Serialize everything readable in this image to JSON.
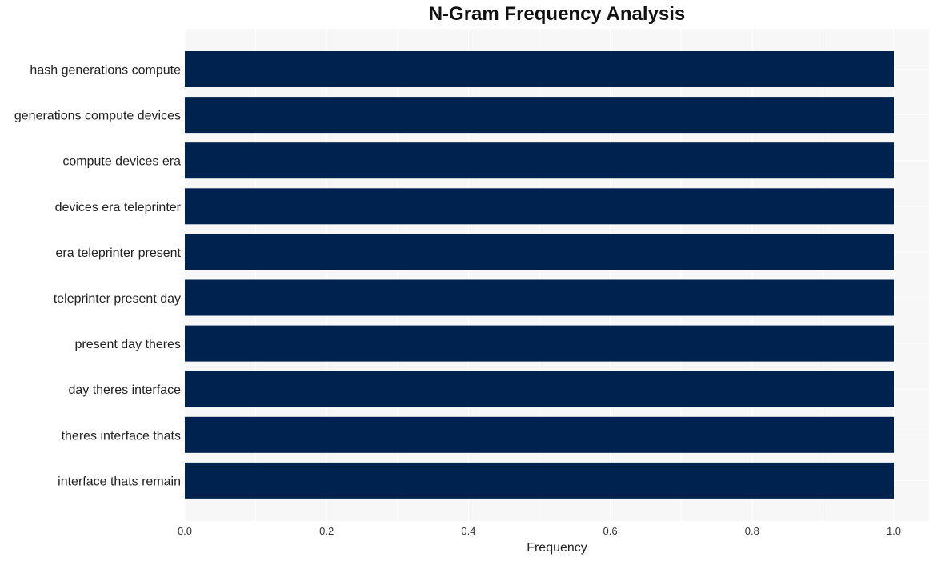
{
  "chart_data": {
    "type": "bar",
    "orientation": "horizontal",
    "title": "N-Gram Frequency Analysis",
    "xlabel": "Frequency",
    "ylabel": "",
    "categories": [
      "hash generations compute",
      "generations compute devices",
      "compute devices era",
      "devices era teleprinter",
      "era teleprinter present",
      "teleprinter present day",
      "present day theres",
      "day theres interface",
      "theres interface thats",
      "interface thats remain"
    ],
    "values": [
      1,
      1,
      1,
      1,
      1,
      1,
      1,
      1,
      1,
      1
    ],
    "xlim": [
      0,
      1.05
    ],
    "xticks": [
      0.0,
      0.2,
      0.4,
      0.6,
      0.8,
      1.0
    ],
    "xtick_labels": [
      "0.0",
      "0.2",
      "0.4",
      "0.6",
      "0.8",
      "1.0"
    ],
    "grid": true,
    "legend": "none",
    "colors": {
      "bar": "#00224e",
      "plot_background": "#f7f7f7",
      "grid": "#ffffff"
    }
  }
}
